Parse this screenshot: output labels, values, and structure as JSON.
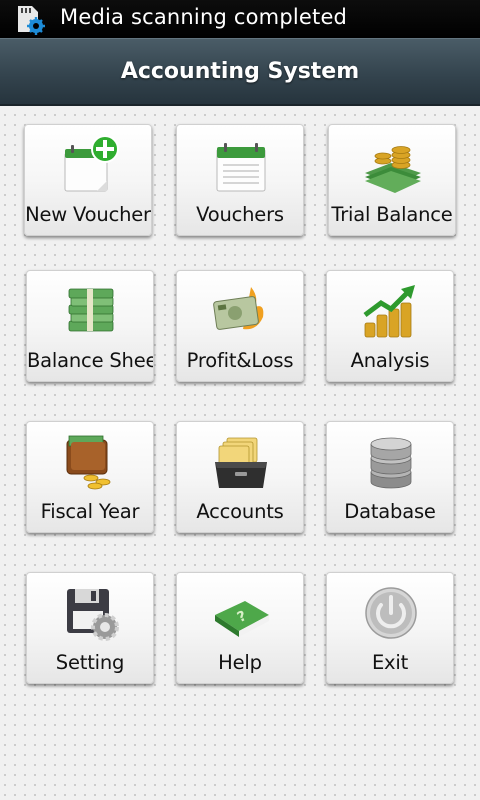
{
  "status_bar": {
    "notification_text": "Media scanning completed",
    "icon": "sd-card-settings-icon"
  },
  "app_bar": {
    "title": "Accounting System"
  },
  "menu": {
    "items": [
      {
        "label": "New Voucher",
        "icon": "new-voucher-icon"
      },
      {
        "label": "Vouchers",
        "icon": "vouchers-icon"
      },
      {
        "label": "Trial Balance",
        "icon": "trial-balance-icon"
      },
      {
        "label": "Balance Sheet",
        "icon": "balance-sheet-icon"
      },
      {
        "label": "Profit&Loss",
        "icon": "profit-loss-icon"
      },
      {
        "label": "Analysis",
        "icon": "analysis-icon"
      },
      {
        "label": "Fiscal Year",
        "icon": "fiscal-year-icon"
      },
      {
        "label": "Accounts",
        "icon": "accounts-icon"
      },
      {
        "label": "Database",
        "icon": "database-icon"
      },
      {
        "label": "Setting",
        "icon": "setting-icon"
      },
      {
        "label": "Help",
        "icon": "help-icon"
      },
      {
        "label": "Exit",
        "icon": "exit-icon"
      }
    ]
  },
  "colors": {
    "title_bar": "#34444e",
    "status_bar": "#000000",
    "background": "#f1f1f1",
    "money_green": "#3c8c3a",
    "gold": "#d9a425"
  }
}
